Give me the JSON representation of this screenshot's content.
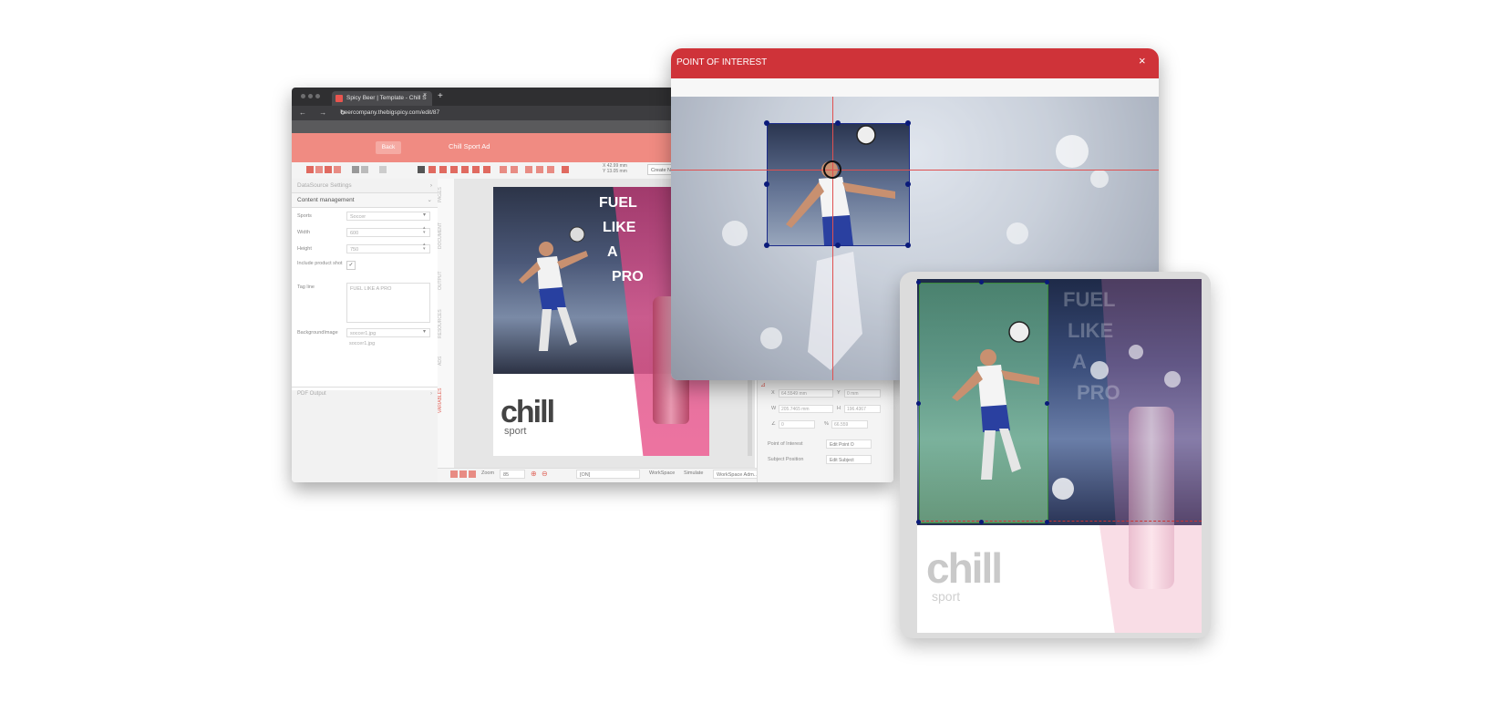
{
  "browser": {
    "tab_title": "Spicy Beer | Template - Chill S",
    "tab_close": "×",
    "new_tab": "+",
    "nav_icons": "← → ↻",
    "url": "beercompany.thebigspicy.com/edit/87"
  },
  "app": {
    "back_label": "Back",
    "title": "Chill Sport Ad",
    "coords": {
      "x": "X   42.99 mm",
      "y": "Y   13.05 mm"
    },
    "create_placeholder": "Create Ne"
  },
  "left_panel": {
    "datasource_label": "DataSource Settings",
    "content_label": "Content management",
    "fields": [
      {
        "label": "Sports",
        "value": "Soccer"
      },
      {
        "label": "Width",
        "value": "600"
      },
      {
        "label": "Height",
        "value": "750"
      },
      {
        "label": "Include product shot",
        "value": "✓"
      },
      {
        "label": "Tag line",
        "value": "FUEL LIKE A PRO"
      },
      {
        "label": "BackgroundImage",
        "value": "soccer1.jpg"
      }
    ],
    "bg_filename": "soccer1.jpg",
    "pdf_output_label": "PDF Output"
  },
  "vtabs": [
    "PAGES",
    "DOCUMENT",
    "OUTPUT",
    "RESOURCES",
    "ADS",
    "VARIABLES"
  ],
  "document": {
    "tagline": [
      "FUEL",
      "LIKE",
      "A",
      "PRO"
    ],
    "brand": "chill",
    "brand_sub": "sport"
  },
  "bottom_bar": {
    "zoom_label": "Zoom",
    "zoom_value": "85",
    "page_value": "[ON]",
    "workspace_label": "WorkSpace",
    "simulate_label": "Simulate",
    "workspace_value": "WorkSpace Adm..."
  },
  "props": {
    "x_label": "X",
    "x_value": "64.5549 mm",
    "y_label": "Y",
    "y_value": "0 mm",
    "w_label": "W",
    "w_value": "205.7465 mm",
    "h_label": "H",
    "h_value": "196.4367",
    "angle_label": "∠",
    "angle_value": "0",
    "pct_label": "%",
    "pct_value": "66.559",
    "poi_label": "Point of Interest",
    "poi_btn": "Edit Point O",
    "subject_label": "Subject Position",
    "subject_btn": "Edit Subject"
  },
  "poi_dialog": {
    "title": "POINT OF INTEREST",
    "close": "×"
  },
  "tablet": {
    "tagline": [
      "FUEL",
      "LIKE",
      "A",
      "PRO"
    ],
    "brand": "chill",
    "brand_sub": "sport"
  },
  "colors": {
    "accent_red": "#cf3339",
    "app_bar": "#f08b82",
    "pink": "#e86a9a"
  }
}
